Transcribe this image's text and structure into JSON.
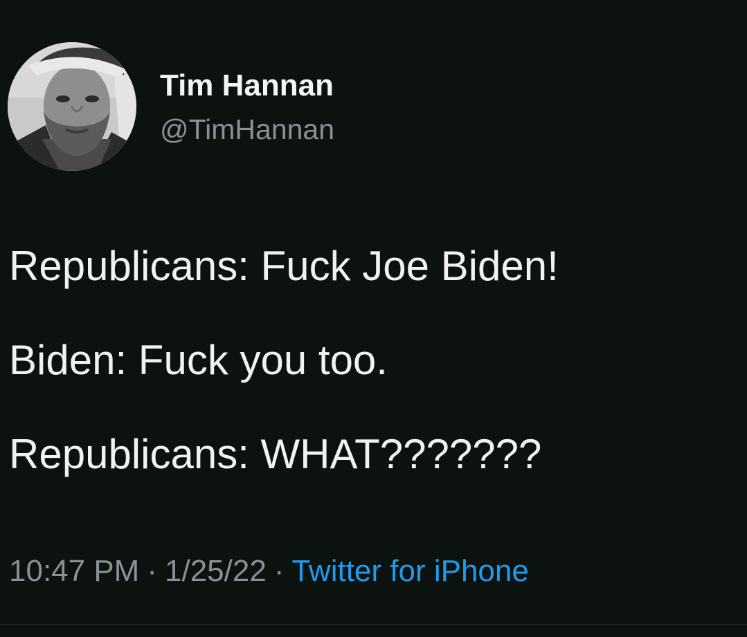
{
  "author": {
    "display_name": "Tim Hannan",
    "handle": "@TimHannan",
    "avatar_icon": "profile-photo"
  },
  "tweet": {
    "lines": [
      "Republicans: Fuck Joe Biden!",
      "Biden: Fuck you too.",
      "Republicans: WHAT???????"
    ]
  },
  "meta": {
    "time": "10:47 PM",
    "separator": "·",
    "date": "1/25/22",
    "source": "Twitter for iPhone"
  },
  "colors": {
    "background": "#0c130f",
    "text": "#f1f3f2",
    "muted": "#8a9196",
    "link": "#1d9bf0"
  }
}
